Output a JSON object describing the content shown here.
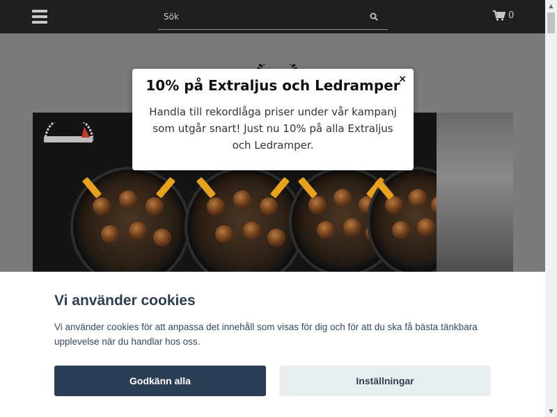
{
  "header": {
    "search_placeholder": "Sök",
    "cart_count": "0",
    "icons": {
      "menu": "hamburger-menu-icon",
      "search": "search-icon",
      "cart": "shopping-cart-icon"
    }
  },
  "popup": {
    "title": "10% på Extraljus och Ledramper",
    "close_label": "×",
    "message": "Handla till rekordlåga priser under vår kampanj som utgår snart! Just nu 10% på alla Extraljus och Ledramper."
  },
  "cookie_banner": {
    "title": "Vi använder cookies",
    "text": "Vi använder cookies för att anpassa det innehåll som visas för dig och för att du ska få bästa tänkbara upplevelse när du handlar hos oss.",
    "accept_label": "Godkänn alla",
    "settings_label": "Inställningar"
  },
  "colors": {
    "topbar": "#1f1f1f",
    "accept_button": "#2c3e55",
    "settings_button": "#e9eef0",
    "cookie_title": "#2c3e50"
  }
}
